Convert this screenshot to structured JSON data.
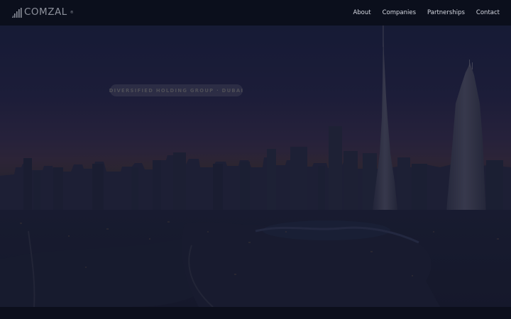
{
  "brand": {
    "name": "COMZAL",
    "registered_mark": "®"
  },
  "nav": {
    "items": [
      {
        "label": "About"
      },
      {
        "label": "Companies"
      },
      {
        "label": "Partnerships"
      },
      {
        "label": "Contact"
      }
    ]
  },
  "hero": {
    "tagline": "Diversified Holding Group · Dubai",
    "background": "dubai-skyline-dusk-photo"
  },
  "colors": {
    "nav_bg": "#0b0f1c",
    "nav_text": "#d6d9e2",
    "logo": "#8d919c",
    "overlay": "#141a33"
  }
}
